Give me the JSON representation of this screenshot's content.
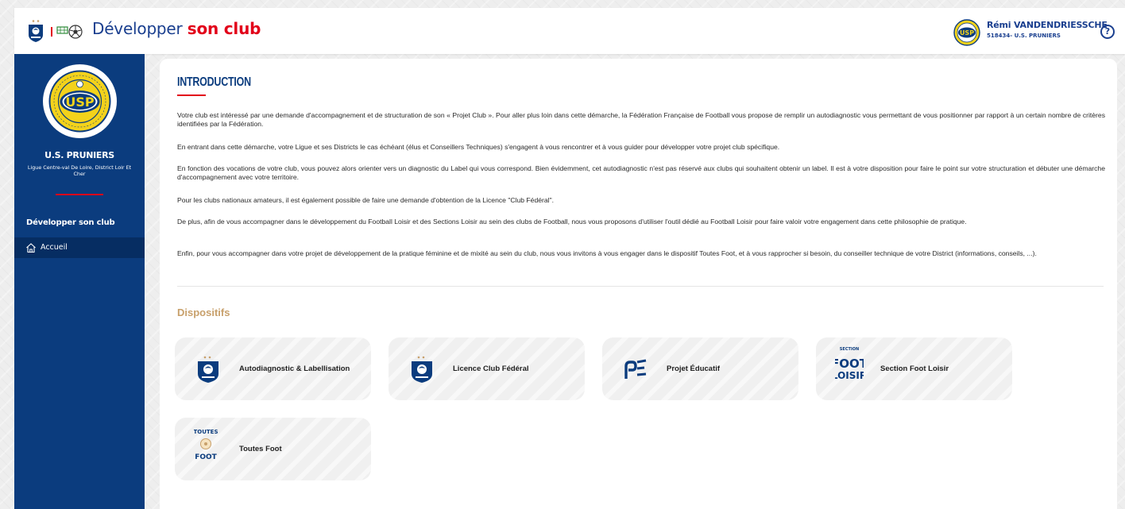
{
  "header": {
    "title_main": "Développer",
    "title_accent": "son club",
    "user_name": "Rémi VANDENDRIESSCHE",
    "user_club": "518434- U.S. PRUNIERS",
    "help_symbol": "?"
  },
  "sidebar": {
    "club_name": "U.S. PRUNIERS",
    "club_league": "Ligue Centre-val De Loire, District Loir Et Cher",
    "club_logo_text": "USP",
    "section_title": "Développer son club",
    "items": [
      {
        "label": "Accueil",
        "icon": "home-icon",
        "active": true
      }
    ]
  },
  "main": {
    "intro_title": "INTRODUCTION",
    "paragraphs": [
      "Votre club est intéressé par une demande d'accompagnement et de structuration de son « Projet Club ». Pour aller plus loin dans cette démarche, la Fédération Française de Football vous propose de remplir un autodiagnostic vous permettant de vous positionner par rapport à un certain nombre de critères identifiées par la Fédération.",
      "En entrant dans cette démarche, votre Ligue et ses Districts le cas échéant (élus et Conseillers Techniques) s'engagent à vous rencontrer et à vous guider pour développer votre projet club spécifique.",
      "En fonction des vocations de votre club, vous pouvez alors orienter vers un diagnostic du Label qui vous correspond. Bien évidemment, cet autodiagnostic n'est pas réservé aux clubs qui souhaitent obtenir un label. Il est à votre disposition pour faire le point sur votre structuration et débuter une démarche d'accompagnement avec votre territoire.",
      "Pour les clubs nationaux amateurs, il est également possible de faire une demande d'obtention de la Licence \"Club Fédéral\".",
      "De plus, afin de vous accompagner dans le développement du Football Loisir et des Sections Loisir au sein des clubs de Football, nous vous proposons d'utiliser l'outil dédié au Football Loisir pour faire valoir votre engagement dans cette philosophie de pratique.",
      "Enfin, pour vous accompagner dans votre projet de développement de la pratique féminine et de mixité au sein du club, nous vous invitons à vous engager dans le dispositif Toutes Foot, et à vous rapprocher si besoin, du conseiller technique de votre District (informations, conseils, ...)."
    ],
    "dispositifs_title": "Dispositifs",
    "cards": [
      {
        "label": "Autodiagnostic & Labellisation",
        "icon": "fff-crest-icon"
      },
      {
        "label": "Licence Club Fédéral",
        "icon": "fff-crest-icon"
      },
      {
        "label": "Projet Éducatif",
        "icon": "projet-educatif-icon"
      },
      {
        "label": "Section Foot Loisir",
        "icon": "foot-loisir-icon",
        "icon_text": [
          "SECTION",
          "FOOT",
          "LOISIR"
        ]
      },
      {
        "label": "Toutes Foot",
        "icon": "toutes-foot-icon",
        "icon_text": [
          "TOUTES",
          "FOOT"
        ]
      }
    ]
  },
  "colors": {
    "navy": "#0b3c7e",
    "red": "#e2001a",
    "gold": "#c8a06b",
    "club_yellow": "#f3d21b"
  }
}
